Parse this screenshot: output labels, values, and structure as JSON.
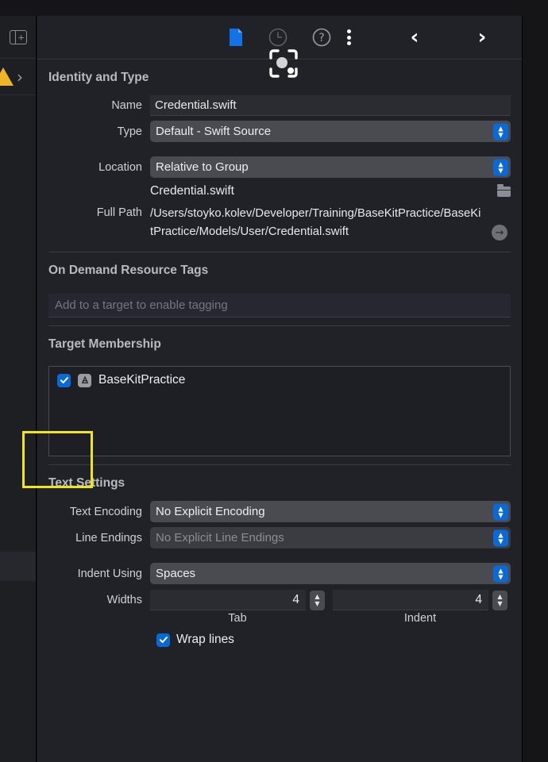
{
  "left_strip": {
    "panel_add_icon": "panel-add-icon",
    "warning_icon": "warning-triangle-icon",
    "disclosure_icon": "chevron-right-icon"
  },
  "toolbar": {
    "document_icon": "document-icon",
    "history_icon": "clock-history-icon",
    "help_icon": "help-question-icon",
    "more_icon": "kebab-menu-icon",
    "back_label": "‹",
    "forward_label": "›"
  },
  "identity": {
    "title": "Identity and Type",
    "name_label": "Name",
    "name_value": "Credential.swift",
    "type_label": "Type",
    "type_value": "Default - Swift Source",
    "location_label": "Location",
    "location_value": "Relative to Group",
    "location_file": "Credential.swift",
    "folder_icon": "folder-icon",
    "full_path_label": "Full Path",
    "full_path_value": "/Users/stoyko.kolev/Developer/Training/BaseKitPractice/BaseKitPractice/Models/User/Credential.swift",
    "reveal_icon": "→"
  },
  "odr": {
    "title": "On Demand Resource Tags",
    "placeholder": "Add to a target to enable tagging"
  },
  "target_membership": {
    "title": "Target Membership",
    "targets": [
      {
        "name": "BaseKitPractice",
        "checked": true,
        "icon": "app-target-icon"
      }
    ]
  },
  "text_settings": {
    "title": "Text Settings",
    "encoding_label": "Text Encoding",
    "encoding_value": "No Explicit Encoding",
    "line_endings_label": "Line Endings",
    "line_endings_value": "No Explicit Line Endings",
    "indent_using_label": "Indent Using",
    "indent_using_value": "Spaces",
    "widths_label": "Widths",
    "tab_width": "4",
    "indent_width": "4",
    "tab_sub_label": "Tab",
    "indent_sub_label": "Indent",
    "wrap_lines_label": "Wrap lines",
    "wrap_lines_checked": true
  },
  "colors": {
    "accent_blue": "#0a69d8",
    "panel_bg": "#212227",
    "annotation_yellow": "#f2e516",
    "warning_yellow": "#f0b429"
  }
}
